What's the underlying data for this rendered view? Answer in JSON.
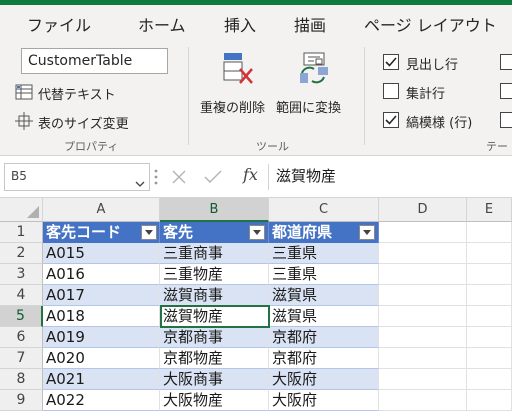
{
  "ribbon_tabs": [
    "ファイル",
    "ホーム",
    "挿入",
    "描画",
    "ページ レイアウト"
  ],
  "properties": {
    "table_name": "CustomerTable",
    "alt_text_label": "代替テキスト",
    "resize_label": "表のサイズ変更",
    "group_label": "プロパティ"
  },
  "tools": {
    "remove_duplicates_label": "重複の削除",
    "convert_to_range_label": "範囲に変換",
    "group_label": "ツール"
  },
  "style_options": {
    "header_row": {
      "label": "見出し行",
      "checked": true
    },
    "total_row": {
      "label": "集計行",
      "checked": false
    },
    "banded_rows": {
      "label": "縞模様 (行)",
      "checked": true
    },
    "group_label_partial": "テー"
  },
  "formula_bar": {
    "name_box": "B5",
    "fx_label": "fx",
    "content": "滋賀物産"
  },
  "columns": [
    "A",
    "B",
    "C",
    "D",
    "E"
  ],
  "rows": [
    "1",
    "2",
    "3",
    "4",
    "5",
    "6",
    "7",
    "8",
    "9"
  ],
  "table": {
    "headers": [
      "客先コード",
      "客先",
      "都道府県"
    ],
    "data": [
      [
        "A015",
        "三重商事",
        "三重県"
      ],
      [
        "A016",
        "三重物産",
        "三重県"
      ],
      [
        "A017",
        "滋賀商事",
        "滋賀県"
      ],
      [
        "A018",
        "滋賀物産",
        "滋賀県"
      ],
      [
        "A019",
        "京都商事",
        "京都府"
      ],
      [
        "A020",
        "京都物産",
        "京都府"
      ],
      [
        "A021",
        "大阪商事",
        "大阪府"
      ],
      [
        "A022",
        "大阪物産",
        "大阪府"
      ]
    ]
  },
  "colors": {
    "header_fill": "#4472c4",
    "band_fill": "#dae3f3",
    "excel_green": "#217346"
  }
}
